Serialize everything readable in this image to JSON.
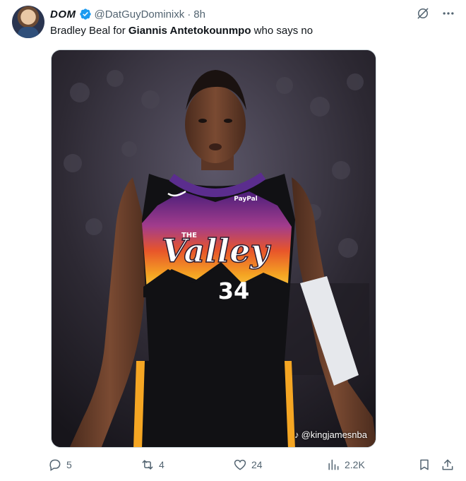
{
  "tweet": {
    "author": {
      "display_name": "DOM",
      "handle": "@DatGuyDominixk",
      "verified": true
    },
    "separator": "·",
    "time": "8h",
    "text_parts": {
      "before": "Bradley Beal for ",
      "bold": "Giannis Antetokounmpo",
      "after": " who says no"
    },
    "media": {
      "jersey_text": "THE",
      "jersey_title": "Valley",
      "jersey_number": "34",
      "sponsor": "PayPal",
      "watermark": "@kingjamesnba"
    },
    "stats": {
      "replies": "5",
      "retweets": "4",
      "likes": "24",
      "views": "2.2K"
    }
  },
  "colors": {
    "text_primary": "#0f1419",
    "text_secondary": "#536471",
    "verified_blue": "#1d9bf0",
    "border": "#cfd9de"
  },
  "icons": {
    "verified": "verified-badge-icon",
    "grok": "grok-icon",
    "more": "more-icon",
    "reply": "reply-icon",
    "retweet": "retweet-icon",
    "like": "heart-icon",
    "views": "views-icon",
    "bookmark": "bookmark-icon",
    "share": "share-icon"
  }
}
